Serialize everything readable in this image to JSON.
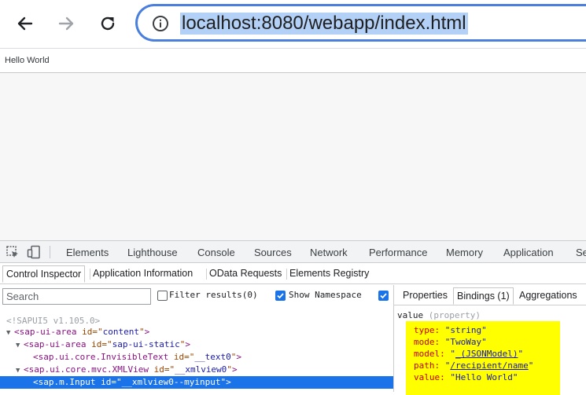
{
  "browser": {
    "url": "localhost:8080/webapp/index.html"
  },
  "page": {
    "hello_text": "Hello World"
  },
  "devtools": {
    "tabs": [
      "Elements",
      "Lighthouse",
      "Console",
      "Sources",
      "Network",
      "Performance",
      "Memory",
      "Application",
      "Se"
    ]
  },
  "ui5_inspector": {
    "tabs": [
      "Control Inspector",
      "Application Information",
      "OData Requests",
      "Elements Registry"
    ],
    "search_placeholder": "Search",
    "filter_label": "Filter results(0)",
    "show_namespace_label": "Show Namespace",
    "tree": {
      "comment": "<!SAPUI5 v1.105.0>",
      "rows": [
        {
          "tag": "sap-ui-area",
          "attr": "id",
          "value": "content"
        },
        {
          "tag": "sap-ui-area",
          "attr": "id",
          "value": "sap-ui-static"
        },
        {
          "tag": "sap.ui.core.InvisibleText",
          "attr": "id",
          "value": "__text0"
        },
        {
          "tag": "sap.ui.core.mvc.XMLView",
          "attr": "id",
          "value": "__xmlview0"
        },
        {
          "tag": "sap.m.Input",
          "attr": "id",
          "value": "__xmlview0--myinput"
        }
      ]
    },
    "right_panel": {
      "tabs": [
        "Properties",
        "Bindings (1)",
        "Aggregations"
      ],
      "property_name": "value",
      "property_kind": "(property)",
      "bindings": {
        "type": {
          "key": "type:",
          "value": "\"string\""
        },
        "mode": {
          "key": "mode:",
          "value": "\"TwoWay\""
        },
        "model": {
          "key": "model:",
          "open": "\"",
          "link": "_(JSONModel)",
          "close": "\""
        },
        "path": {
          "key": "path:",
          "open": "\"",
          "link": "/recipient/name",
          "close": "\""
        },
        "value": {
          "key": "value:",
          "value": "\"Hello World\""
        }
      }
    }
  },
  "colors": {
    "selection": "#1a73e8",
    "omnibox_border": "#4a7fdd",
    "url_highlight": "#b3d0f7",
    "binding_highlight": "#ffff00"
  }
}
